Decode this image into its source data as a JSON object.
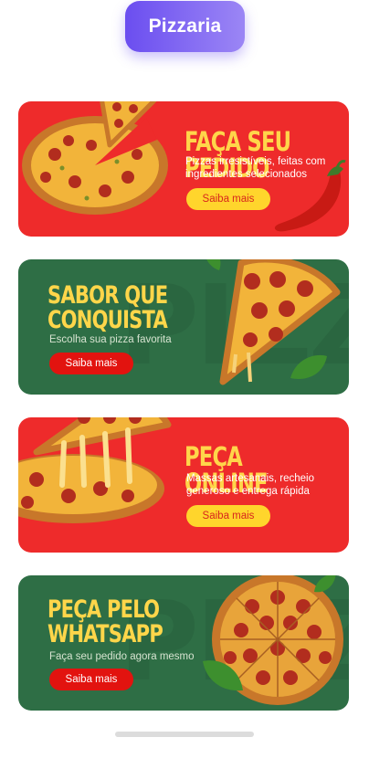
{
  "header": {
    "title": "Pizzaria"
  },
  "banners": [
    {
      "title": "FAÇA SEU PEDIDO",
      "description": "Pizzas irresistíveis, feitas com ingredientes selecionados",
      "button": "Saiba mais"
    },
    {
      "title_line1": "SABOR QUE",
      "title_line2": "CONQUISTA",
      "description": "Escolha sua pizza favorita",
      "button": "Saiba mais",
      "background_word": "PIZZA"
    },
    {
      "title": "PEÇA ONLINE",
      "description": "Massas artesanais, recheio generoso e entrega rápida",
      "button": "Saiba mais"
    },
    {
      "title_line1": "PEÇA PELO",
      "title_line2": "WHATSAPP",
      "description": "Faça seu pedido agora mesmo",
      "button": "Saiba mais",
      "background_word": "PIZZA"
    }
  ],
  "colors": {
    "header_gradient_start": "#6b4ef0",
    "header_gradient_end": "#9b86f5",
    "red_banner": "#ee2b2b",
    "green_banner": "#2e6e45",
    "title_yellow": "#ffd64a",
    "button_yellow": "#ffd52c",
    "button_red": "#e2130f"
  },
  "icons": [
    "pizza-whole-image",
    "pizza-slice-image",
    "chili-pepper-image",
    "basil-leaf-image"
  ]
}
